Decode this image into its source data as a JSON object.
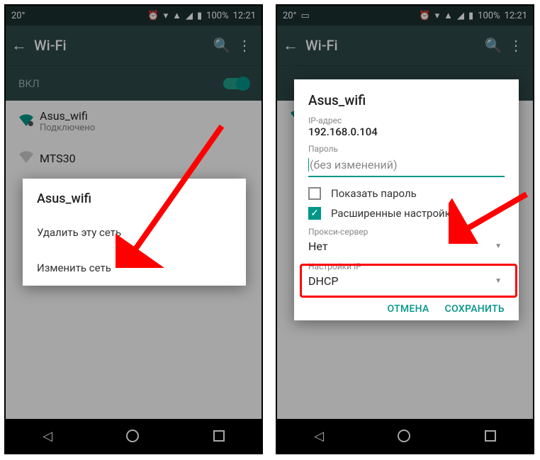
{
  "status": {
    "temp": "20°",
    "battery": "100%",
    "time": "12:21"
  },
  "appbar": {
    "title": "Wi-Fi"
  },
  "toggle": {
    "label": "ВКЛ"
  },
  "networks": [
    {
      "name": "Asus_wifi",
      "status": "Подключено",
      "connected": true
    },
    {
      "name": "MTS30",
      "status": "",
      "connected": false
    }
  ],
  "dialog1": {
    "title": "Asus_wifi",
    "options": [
      "Удалить эту сеть",
      "Изменить сеть"
    ]
  },
  "dialog2": {
    "title": "Asus_wifi",
    "ip_label": "IP-адрес",
    "ip_value": "192.168.0.104",
    "password_label": "Пароль",
    "password_placeholder": "(без изменений)",
    "show_password": "Показать пароль",
    "advanced": "Расширенные настройки",
    "proxy_label": "Прокси-сервер",
    "proxy_value": "Нет",
    "ip_settings_label": "Настройки IP",
    "ip_settings_value": "DHCP",
    "cancel": "ОТМЕНА",
    "save": "СОХРАНИТЬ"
  }
}
